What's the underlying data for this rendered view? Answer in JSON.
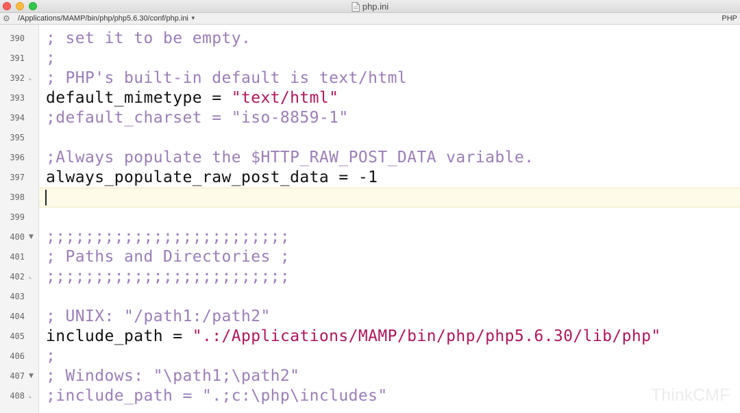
{
  "window": {
    "title": "php.ini",
    "file_path": "/Applications/MAMP/bin/php/php5.6.30/conf/php.ini",
    "syntax": "PHP"
  },
  "editor": {
    "lines": [
      {
        "num": "390",
        "fold": "",
        "tokens": [
          {
            "t": "comment",
            "v": "; set it to be empty."
          }
        ]
      },
      {
        "num": "391",
        "fold": "",
        "tokens": [
          {
            "t": "comment",
            "v": ";"
          }
        ]
      },
      {
        "num": "392",
        "fold": "end",
        "tokens": [
          {
            "t": "comment",
            "v": "; PHP's built-in default is text/html"
          }
        ]
      },
      {
        "num": "393",
        "fold": "",
        "tokens": [
          {
            "t": "plain",
            "v": "default_mimetype = "
          },
          {
            "t": "string",
            "v": "\"text/html\""
          }
        ]
      },
      {
        "num": "394",
        "fold": "",
        "tokens": [
          {
            "t": "comment",
            "v": ";default_charset = \"iso-8859-1\""
          }
        ]
      },
      {
        "num": "395",
        "fold": "",
        "tokens": []
      },
      {
        "num": "396",
        "fold": "",
        "tokens": [
          {
            "t": "comment",
            "v": ";Always populate the $HTTP_RAW_POST_DATA variable."
          }
        ]
      },
      {
        "num": "397",
        "fold": "",
        "tokens": [
          {
            "t": "plain",
            "v": "always_populate_raw_post_data = -1"
          }
        ]
      },
      {
        "num": "398",
        "fold": "",
        "tokens": [],
        "current": true
      },
      {
        "num": "399",
        "fold": "",
        "tokens": []
      },
      {
        "num": "400",
        "fold": "start",
        "tokens": [
          {
            "t": "comment",
            "v": ";;;;;;;;;;;;;;;;;;;;;;;;;"
          }
        ]
      },
      {
        "num": "401",
        "fold": "",
        "tokens": [
          {
            "t": "comment",
            "v": "; Paths and Directories ;"
          }
        ]
      },
      {
        "num": "402",
        "fold": "end",
        "tokens": [
          {
            "t": "comment",
            "v": ";;;;;;;;;;;;;;;;;;;;;;;;;"
          }
        ]
      },
      {
        "num": "403",
        "fold": "",
        "tokens": []
      },
      {
        "num": "404",
        "fold": "",
        "tokens": [
          {
            "t": "comment",
            "v": "; UNIX: \"/path1:/path2\""
          }
        ]
      },
      {
        "num": "405",
        "fold": "",
        "tokens": [
          {
            "t": "plain",
            "v": "include_path = "
          },
          {
            "t": "string",
            "v": "\".:/Applications/MAMP/bin/php/php5.6.30/lib/php\""
          }
        ]
      },
      {
        "num": "406",
        "fold": "",
        "tokens": [
          {
            "t": "comment",
            "v": ";"
          }
        ]
      },
      {
        "num": "407",
        "fold": "start",
        "tokens": [
          {
            "t": "comment",
            "v": "; Windows: \"\\path1;\\path2\""
          }
        ]
      },
      {
        "num": "408",
        "fold": "end",
        "tokens": [
          {
            "t": "comment",
            "v": ";include_path = \".;c:\\php\\includes\""
          }
        ]
      }
    ]
  },
  "watermark": "ThinkCMF"
}
